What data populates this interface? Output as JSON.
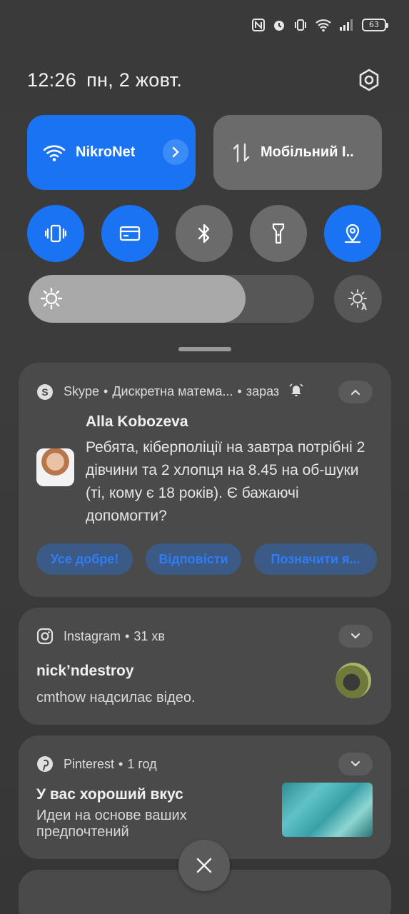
{
  "status_bar": {
    "battery_level": "63",
    "icons": [
      "nfc-icon",
      "alarm-icon",
      "vibrate-icon",
      "wifi-icon",
      "signal-icon",
      "battery-icon"
    ]
  },
  "header": {
    "time": "12:26",
    "date": "пн, 2 жовт."
  },
  "quick_tiles": {
    "wifi": {
      "label": "NikroNet",
      "active": true
    },
    "mobile": {
      "label": "Мобільний І..",
      "active": false
    },
    "toggles": [
      {
        "name": "vibrate",
        "active": true
      },
      {
        "name": "card",
        "active": true
      },
      {
        "name": "bluetooth",
        "active": false
      },
      {
        "name": "flashlight",
        "active": false
      },
      {
        "name": "location",
        "active": true
      }
    ]
  },
  "brightness": {
    "level": 0.76
  },
  "notifications": {
    "skype": {
      "app": "Skype",
      "conversation": "Дискретна матема...",
      "time": "зараз",
      "sender": "Alla Kobozeva",
      "message": "Ребята, кіберполіції на завтра потрібні 2 дівчини та 2 хлопця на 8.45 на об-шуки (ті, кому є 18 років). Є бажаючі допомогти?",
      "actions": [
        "Усе добре!",
        "Відповісти",
        "Позначити я..."
      ]
    },
    "instagram": {
      "app": "Instagram",
      "time": "31 хв",
      "title": "nick’ndestroy",
      "text": "cmthow надсилає відео."
    },
    "pinterest": {
      "app": "Pinterest",
      "time": "1 год",
      "title": "У вас хороший вкус",
      "text": "Идеи на основе ваших предпочтений"
    }
  },
  "colors": {
    "accent": "#1a73f2",
    "tile_off": "#6b6b6b",
    "card_bg": "#4a4a4a",
    "action_text": "#2f7cf5"
  }
}
